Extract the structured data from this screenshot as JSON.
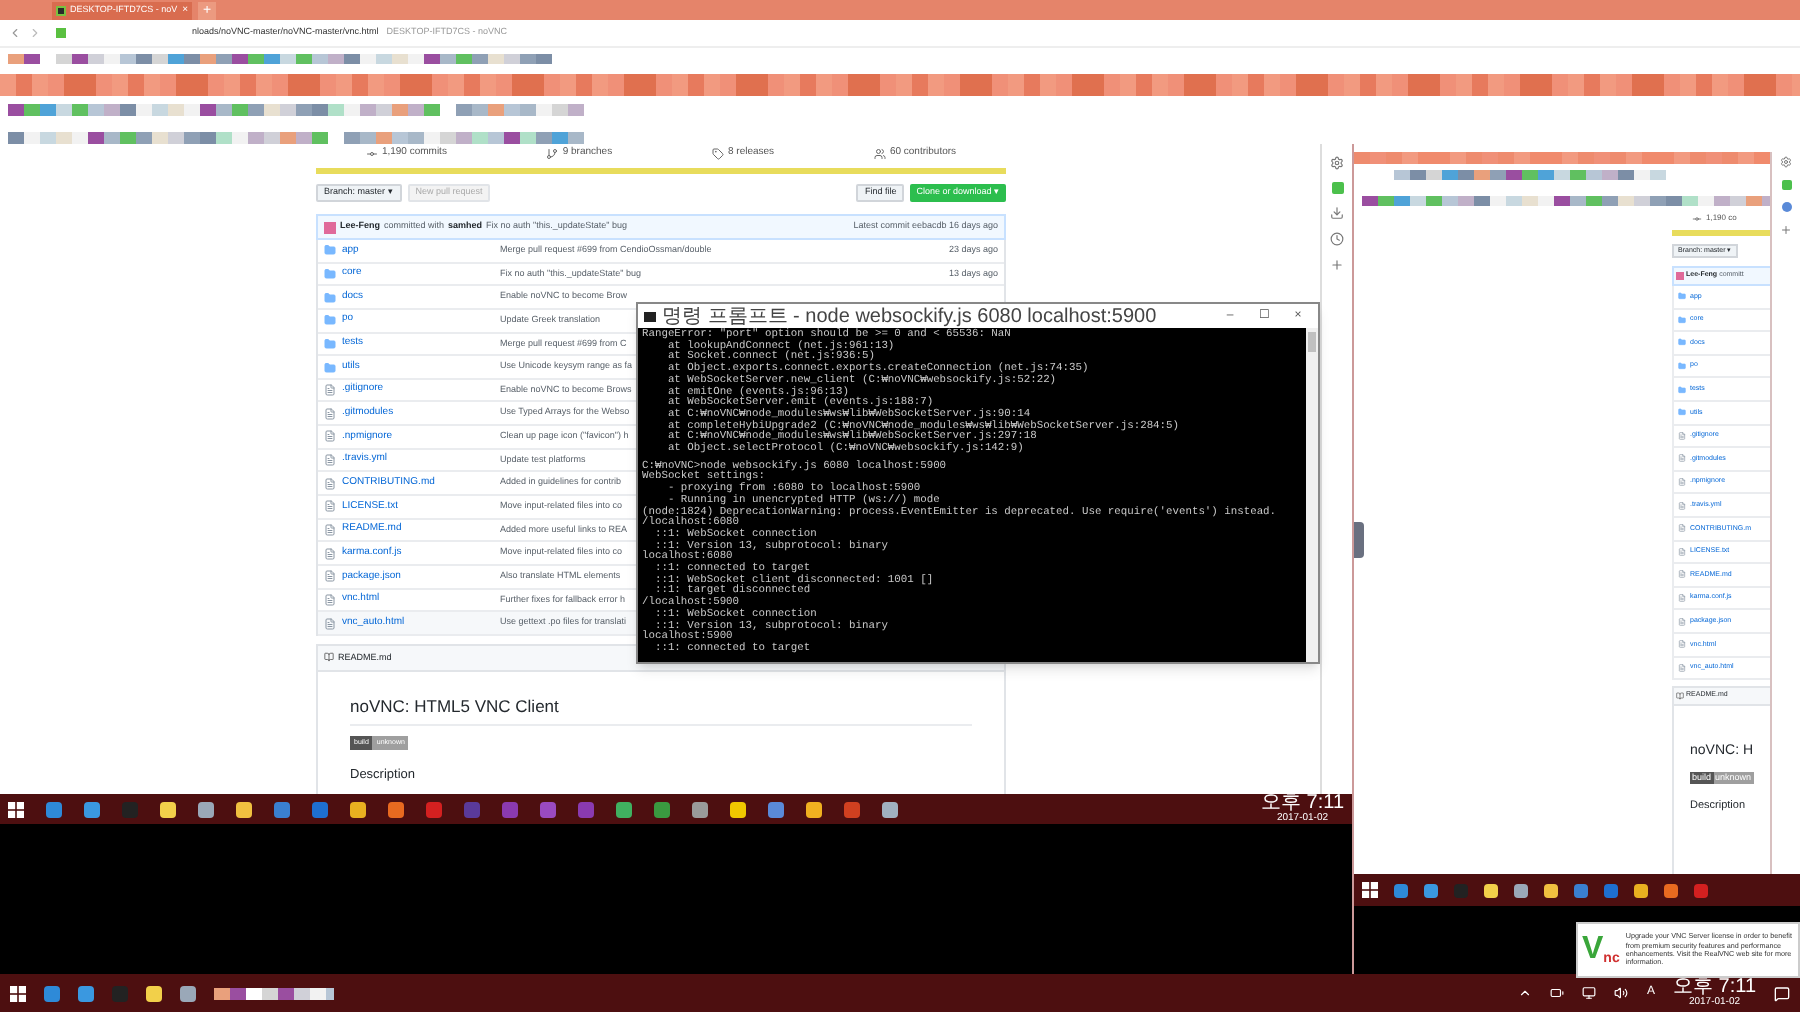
{
  "browser": {
    "tab": {
      "title": "DESKTOP-IFTD7CS - noV",
      "close": "×"
    },
    "new_tab": "+",
    "url": "nloads/noVNC-master/noVNC-master/vnc.html",
    "page_title": "DESKTOP-IFTD7CS - noVNC"
  },
  "repo": {
    "stats": [
      {
        "kind": "commits",
        "label": "1,190 commits"
      },
      {
        "kind": "branches",
        "label": "9 branches"
      },
      {
        "kind": "releases",
        "label": "8 releases"
      },
      {
        "kind": "contributors",
        "label": "60 contributors"
      }
    ],
    "branch_button": "Branch: master ▾",
    "new_pull_request": {
      "label": "New pull request",
      "disabled": true
    },
    "find_file": "Find file",
    "clone": "Clone or download ▾",
    "commit": {
      "author": "Lee-Feng",
      "text": "committed with",
      "coauthor": "samhed",
      "message": "Fix no auth \"this._updateState\" bug",
      "latest": "Latest commit eebacdb 16 days ago"
    },
    "files": [
      {
        "kind": "folder",
        "name": "app",
        "message": "Merge pull request #699 from CendioOssman/double",
        "age": "23 days ago"
      },
      {
        "kind": "folder",
        "name": "core",
        "message": "Fix no auth \"this._updateState\" bug",
        "age": "13 days ago"
      },
      {
        "kind": "folder",
        "name": "docs",
        "message": "Enable noVNC to become Brow"
      },
      {
        "kind": "folder",
        "name": "po",
        "message": "Update Greek translation"
      },
      {
        "kind": "folder",
        "name": "tests",
        "message": "Merge pull request #699 from C"
      },
      {
        "kind": "folder",
        "name": "utils",
        "message": "Use Unicode keysym range as fa"
      },
      {
        "kind": "file",
        "name": ".gitignore",
        "message": "Enable noVNC to become Brows"
      },
      {
        "kind": "file",
        "name": ".gitmodules",
        "message": "Use Typed Arrays for the Webso"
      },
      {
        "kind": "file",
        "name": ".npmignore",
        "message": "Clean up page icon (\"favicon\") h"
      },
      {
        "kind": "file",
        "name": ".travis.yml",
        "message": "Update test platforms"
      },
      {
        "kind": "file",
        "name": "CONTRIBUTING.md",
        "message": "Added in guidelines for contrib"
      },
      {
        "kind": "file",
        "name": "LICENSE.txt",
        "message": "Move input-related files into co"
      },
      {
        "kind": "file",
        "name": "README.md",
        "message": "Added more useful links to REA"
      },
      {
        "kind": "file",
        "name": "karma.conf.js",
        "message": "Move input-related files into co"
      },
      {
        "kind": "file",
        "name": "package.json",
        "message": "Also translate HTML elements"
      },
      {
        "kind": "file",
        "name": "vnc.html",
        "message": "Further fixes for fallback error h"
      },
      {
        "kind": "file",
        "name": "vnc_auto.html",
        "message": "Use gettext .po files for translati"
      }
    ],
    "readme": {
      "header": "README.md",
      "title": "noVNC: HTML5 VNC Client",
      "badge": [
        "build",
        "unknown"
      ],
      "section": "Description"
    }
  },
  "console": {
    "title": "명령 프롬프트 - node  websockify.js 6080 localhost:5900",
    "controls": [
      "–",
      "☐",
      "×"
    ],
    "blocks": [
      [
        "RangeError: \"port\" option should be >= 0 and < 65536: NaN",
        "    at lookupAndConnect (net.js:961:13)",
        "    at Socket.connect (net.js:936:5)",
        "    at Object.exports.connect.exports.createConnection (net.js:74:35)",
        "    at WebSocketServer.new_client (C:₩noVNC₩websockify.js:52:22)",
        "    at emitOne (events.js:96:13)",
        "    at WebSocketServer.emit (events.js:188:7)",
        "    at C:₩noVNC₩node_modules₩ws₩lib₩WebSocketServer.js:90:14",
        "    at completeHybiUpgrade2 (C:₩noVNC₩node_modules₩ws₩lib₩WebSocketServer.js:284:5)",
        "    at C:₩noVNC₩node_modules₩ws₩lib₩WebSocketServer.js:297:18",
        "    at Object.selectProtocol (C:₩noVNC₩websockify.js:142:9)"
      ],
      [
        "C:₩noVNC>node websockify.js 6080 localhost:5900",
        "WebSocket settings:",
        "    - proxying from :6080 to localhost:5900",
        "    - Running in unencrypted HTTP (ws://) mode",
        "(node:1824) DeprecationWarning: process.EventEmitter is deprecated. Use require('events') instead.",
        "/localhost:6080",
        "  ::1: WebSocket connection",
        "  ::1: Version 13, subprotocol: binary",
        "localhost:6080",
        "  ::1: connected to target",
        "  ::1: WebSocket client disconnected: 1001 []",
        "  ::1: target disconnected",
        "/localhost:5900",
        "  ::1: WebSocket connection",
        "  ::1: Version 13, subprotocol: binary",
        "localhost:5900",
        "  ::1: connected to target"
      ]
    ]
  },
  "taskbar": {
    "time": "오후 7:11",
    "date": "2017-01-02"
  },
  "remote": {
    "stats": "1,190 co",
    "branch_button": "Branch: master ▾",
    "commit_author": "Lee-Feng",
    "commit_text": "committ",
    "files": [
      {
        "kind": "folder",
        "name": "app"
      },
      {
        "kind": "folder",
        "name": "core"
      },
      {
        "kind": "folder",
        "name": "docs"
      },
      {
        "kind": "folder",
        "name": "po"
      },
      {
        "kind": "folder",
        "name": "tests"
      },
      {
        "kind": "folder",
        "name": "utils"
      },
      {
        "kind": "file",
        "name": ".gitignore"
      },
      {
        "kind": "file",
        "name": ".gitmodules"
      },
      {
        "kind": "file",
        "name": ".npmignore"
      },
      {
        "kind": "file",
        "name": ".travis.yml"
      },
      {
        "kind": "file",
        "name": "CONTRIBUTING.m"
      },
      {
        "kind": "file",
        "name": "LICENSE.txt"
      },
      {
        "kind": "file",
        "name": "README.md"
      },
      {
        "kind": "file",
        "name": "karma.conf.js"
      },
      {
        "kind": "file",
        "name": "package.json"
      },
      {
        "kind": "file",
        "name": "vnc.html"
      },
      {
        "kind": "file",
        "name": "vnc_auto.html"
      }
    ],
    "readme_header": "README.md",
    "title": "noVNC: H",
    "badge": [
      "build",
      "unknown"
    ],
    "section": "Description"
  },
  "notification": {
    "logo_main": "V",
    "logo_sub": "nc",
    "text": "Upgrade your VNC Server license in order to benefit from premium security features and performance enhancements. Visit the RealVNC web site for more information."
  },
  "system_tray": {
    "ime": "A",
    "time": "오후 7:11",
    "date": "2017-01-02"
  }
}
